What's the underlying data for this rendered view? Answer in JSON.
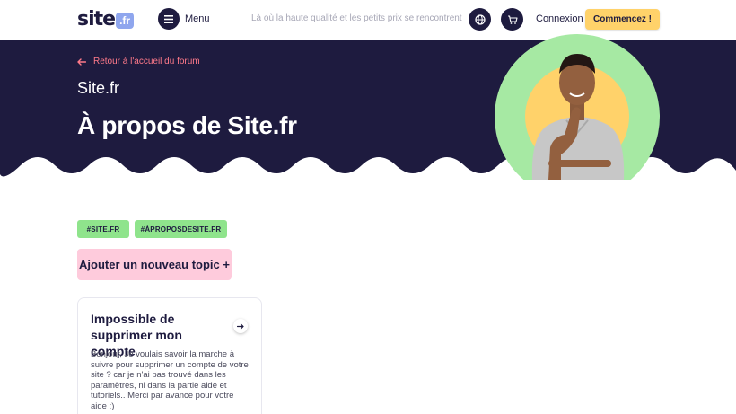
{
  "header": {
    "logo_text": "site",
    "logo_badge": ".fr",
    "menu_label": "Menu",
    "tagline": "Là où la haute qualité et les petits prix se rencontrent",
    "login_label": "Connexion",
    "cta_label": "Commencez !"
  },
  "hero": {
    "back_label": "Retour à l'accueil du forum",
    "breadcrumb": "Site.fr",
    "title": "À propos de Site.fr"
  },
  "tags": [
    "#SITE.FR",
    "#ÀPROPOSDESITE.FR"
  ],
  "add_topic_label": "Ajouter un nouveau topic +",
  "card": {
    "title": "Impossible de supprimer mon compte",
    "body": "Bonjour, Je voulais savoir la marche à suivre pour supprimer un compte de votre site ? car je n'ai pas trouvé dans les paramètres, ni dans la partie aide et tutoriels.. Merci par avance pour votre aide :)"
  },
  "colors": {
    "navy": "#1e1b3f",
    "accent_yellow": "#ffd26a",
    "tag_green": "#8fe48c",
    "topic_pink": "#fecbdc",
    "link_pink": "#ff7a8a",
    "logo_blue": "#8fa6ee"
  },
  "icons": [
    "menu-icon",
    "globe-icon",
    "cart-icon",
    "arrow-left-icon",
    "arrow-right-icon"
  ]
}
